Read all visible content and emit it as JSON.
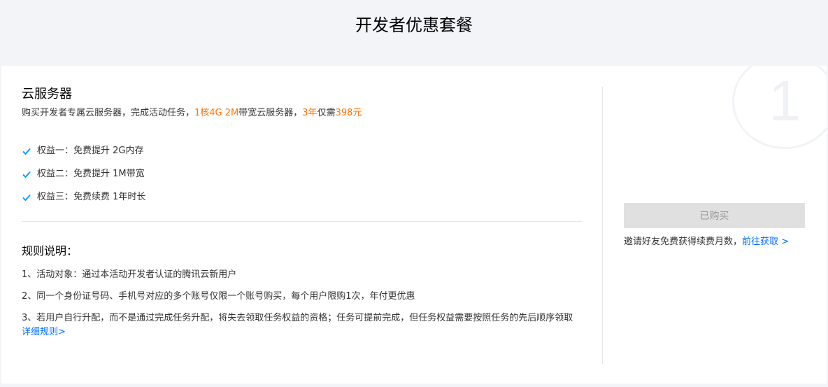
{
  "header": {
    "title": "开发者优惠套餐"
  },
  "card": {
    "bg_number": "1",
    "product": {
      "title": "云服务器",
      "desc_part1": "购买开发者专属云服务器，完成活动任务，",
      "desc_spec": "1核4G 2M",
      "desc_part2": "带宽云服务器，",
      "desc_years": "3年",
      "desc_part3": "仅需",
      "desc_price": "398元"
    },
    "benefits": [
      "权益一：免费提升 2G内存",
      "权益二：免费提升 1M带宽",
      "权益三：免费续费 1年时长"
    ],
    "rules": {
      "title": "规则说明：",
      "items": [
        "1、活动对象：通过本活动开发者认证的腾讯云新用户",
        "2、同一个身份证号码、手机号对应的多个账号仅限一个账号购买，每个用户限购1次，年付更优惠",
        "3、若用户自行升配，而不是通过完成任务升配，将失去领取任务权益的资格；任务可提前完成，但任务权益需要按照任务的先后顺序领取"
      ],
      "detail_link": "详细规则>"
    },
    "purchase": {
      "button_label": "已购买",
      "invite_text": "邀请好友免费获得续费月数，",
      "invite_link": "前往获取 >"
    }
  },
  "colors": {
    "highlight": "#ff7200",
    "link": "#006eff",
    "check": "#00a4ff"
  },
  "icons": {
    "benefit_check": "check-icon"
  }
}
